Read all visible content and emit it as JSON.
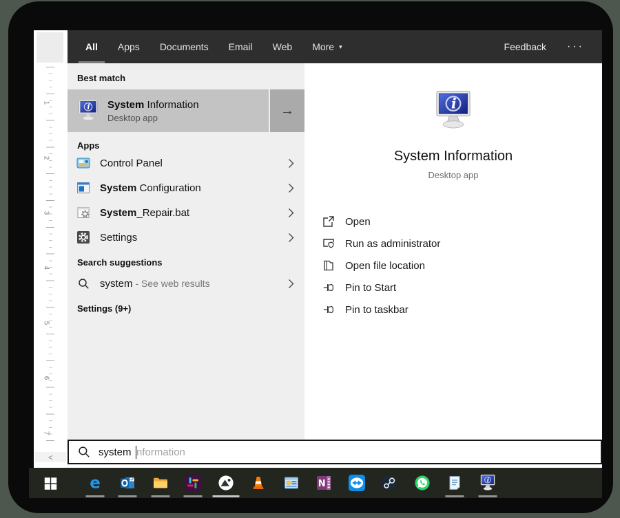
{
  "tabs": {
    "items": [
      "All",
      "Apps",
      "Documents",
      "Email",
      "Web",
      "More"
    ],
    "more_caret": "▾",
    "feedback": "Feedback",
    "overflow": "···"
  },
  "left": {
    "best_match_header": "Best match",
    "best_match": {
      "title_bold": "System",
      "title_rest": " Information",
      "subtitle": "Desktop app",
      "icon": "system-information"
    },
    "apps_header": "Apps",
    "app_items": [
      {
        "icon": "control-panel",
        "bold": "",
        "rest": "Control Panel"
      },
      {
        "icon": "system-configuration",
        "bold": "System",
        "rest": " Configuration"
      },
      {
        "icon": "batch-file",
        "bold": "System",
        "rest": "_Repair.bat"
      },
      {
        "icon": "settings-gear",
        "bold": "",
        "rest": "Settings"
      }
    ],
    "suggestions_header": "Search suggestions",
    "suggestion": {
      "icon": "search",
      "term": "system",
      "rest": " - See web results"
    },
    "settings_header": "Settings (9+)"
  },
  "right": {
    "title": "System Information",
    "subtitle": "Desktop app",
    "icon": "system-information",
    "actions": [
      {
        "icon": "open",
        "label": "Open"
      },
      {
        "icon": "run-admin",
        "label": "Run as administrator"
      },
      {
        "icon": "file-location",
        "label": "Open file location"
      },
      {
        "icon": "pin",
        "label": "Pin to Start"
      },
      {
        "icon": "pin",
        "label": "Pin to taskbar"
      }
    ]
  },
  "search_box": {
    "typed": "system",
    "ghost": "nformation"
  },
  "ruler_numbers": [
    "1",
    "2",
    "3",
    "4",
    "5",
    "6",
    "7"
  ],
  "taskbar": {
    "items": [
      {
        "name": "edge",
        "running": true,
        "active": false
      },
      {
        "name": "outlook",
        "running": true,
        "active": false
      },
      {
        "name": "file-explorer",
        "running": true,
        "active": false
      },
      {
        "name": "slack",
        "running": true,
        "active": false
      },
      {
        "name": "photos-circle",
        "running": true,
        "active": true
      },
      {
        "name": "vlc",
        "running": false,
        "active": false
      },
      {
        "name": "system-window",
        "running": false,
        "active": false
      },
      {
        "name": "onenote",
        "running": false,
        "active": false
      },
      {
        "name": "teamviewer",
        "running": false,
        "active": false
      },
      {
        "name": "steam",
        "running": false,
        "active": false
      },
      {
        "name": "whatsapp",
        "running": false,
        "active": false
      },
      {
        "name": "notepad",
        "running": true,
        "active": false
      },
      {
        "name": "system-information",
        "running": true,
        "active": false
      }
    ]
  },
  "colors": {
    "outer_background": "#4d574e",
    "frame": "#0a0a0a",
    "tab_bar": "#2e2e2e",
    "left_panel": "#efefef",
    "highlight_row": "#c3c3c3",
    "arrow_cell": "#aaaaaa",
    "taskbar": "#23251f",
    "screen_blue": "#2a3fb0"
  }
}
